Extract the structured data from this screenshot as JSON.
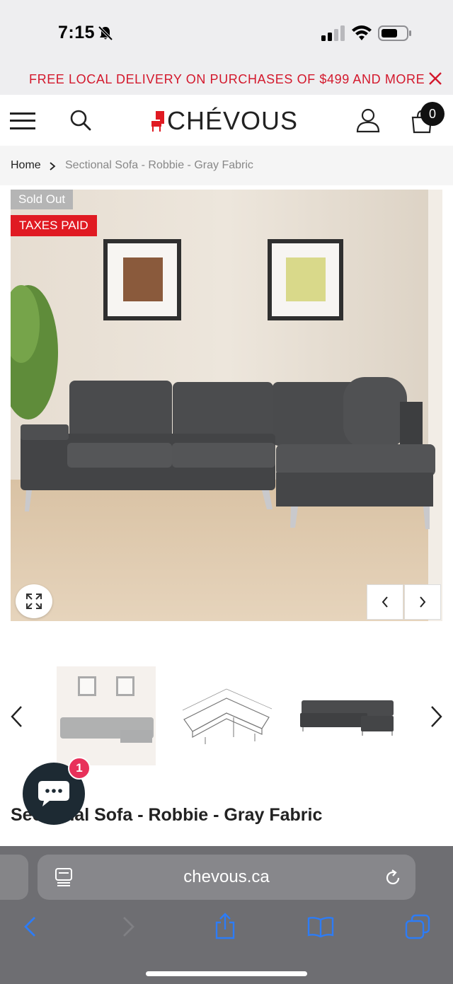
{
  "status_bar": {
    "time": "7:15",
    "icons": [
      "bell-slash-icon",
      "signal-icon",
      "wifi-icon",
      "battery-icon"
    ]
  },
  "promo": {
    "text": "FREE LOCAL DELIVERY ON PURCHASES OF $499 AND MORE",
    "color": "#d3182c"
  },
  "header": {
    "logo_text": "CHÉVOUS",
    "brand_color": "#e01a22",
    "cart_count": "0"
  },
  "breadcrumb": {
    "home": "Home",
    "current": "Sectional Sofa - Robbie - Gray Fabric"
  },
  "product": {
    "badges": {
      "sold_out": "Sold Out",
      "taxes_paid": "TAXES PAID"
    },
    "title": "Sectional Sofa - Robbie - Gray Fabric"
  },
  "chat": {
    "unread": "1"
  },
  "browser": {
    "url": "chevous.ca"
  }
}
